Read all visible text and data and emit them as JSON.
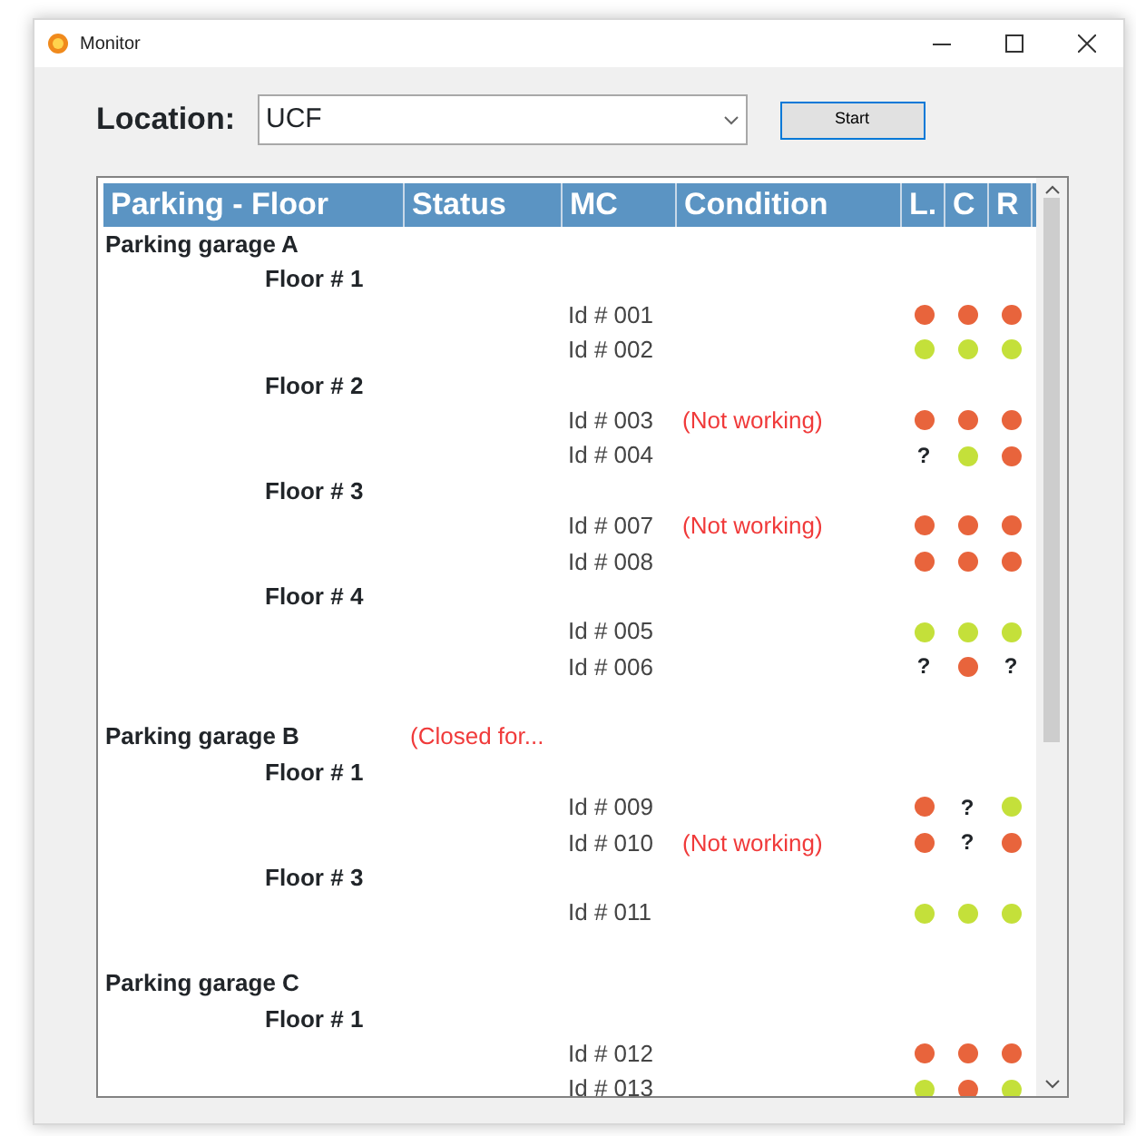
{
  "window": {
    "title": "Monitor"
  },
  "location": {
    "label": "Location:",
    "value": "UCF"
  },
  "start_button": "Start",
  "table": {
    "columns": [
      "Parking - Floor",
      "Status",
      "MC",
      "Condition",
      "L.",
      "C",
      "R"
    ],
    "garages": [
      {
        "name": "Parking garage A",
        "children": [
          {
            "name": "Floor # 1",
            "children": [
              {
                "id": "Id # 001",
                "indicators": [
                  {
                    "kind": "light",
                    "color": "#e8643c"
                  },
                  {
                    "kind": "light",
                    "color": "#e8643c"
                  },
                  {
                    "kind": "light",
                    "color": "#e8643c"
                  }
                ]
              },
              {
                "id": "Id # 002",
                "indicators": [
                  {
                    "kind": "light",
                    "color": "#c4e03a"
                  },
                  {
                    "kind": "light",
                    "color": "#c4e03a"
                  },
                  {
                    "kind": "light",
                    "color": "#c4e03a"
                  }
                ]
              }
            ]
          },
          {
            "name": "Floor # 2",
            "children": [
              {
                "id": "Id # 003",
                "condition": "(Not working)",
                "indicators": [
                  {
                    "kind": "light",
                    "color": "#e8643c"
                  },
                  {
                    "kind": "light",
                    "color": "#e8643c"
                  },
                  {
                    "kind": "light",
                    "color": "#e8643c"
                  }
                ]
              },
              {
                "id": "Id # 004",
                "indicators": [
                  {
                    "kind": "unknown",
                    "text": "?"
                  },
                  {
                    "kind": "light",
                    "color": "#c4e03a"
                  },
                  {
                    "kind": "light",
                    "color": "#e8643c"
                  }
                ]
              }
            ]
          },
          {
            "name": "Floor # 3",
            "children": [
              {
                "id": "Id # 007",
                "condition": "(Not working)",
                "indicators": [
                  {
                    "kind": "light",
                    "color": "#e8643c"
                  },
                  {
                    "kind": "light",
                    "color": "#e8643c"
                  },
                  {
                    "kind": "light",
                    "color": "#e8643c"
                  }
                ]
              },
              {
                "id": "Id # 008",
                "indicators": [
                  {
                    "kind": "light",
                    "color": "#e8643c"
                  },
                  {
                    "kind": "light",
                    "color": "#e8643c"
                  },
                  {
                    "kind": "light",
                    "color": "#e8643c"
                  }
                ]
              }
            ]
          },
          {
            "name": "Floor # 4",
            "children": [
              {
                "id": "Id # 005",
                "indicators": [
                  {
                    "kind": "light",
                    "color": "#c4e03a"
                  },
                  {
                    "kind": "light",
                    "color": "#c4e03a"
                  },
                  {
                    "kind": "light",
                    "color": "#c4e03a"
                  }
                ]
              },
              {
                "id": "Id # 006",
                "indicators": [
                  {
                    "kind": "unknown",
                    "text": "?"
                  },
                  {
                    "kind": "light",
                    "color": "#e8643c"
                  },
                  {
                    "kind": "unknown",
                    "text": "?"
                  }
                ]
              }
            ]
          }
        ]
      },
      {
        "name": "Parking garage B",
        "status": "(Closed for...",
        "children": [
          {
            "name": "Floor # 1",
            "children": [
              {
                "id": "Id # 009",
                "indicators": [
                  {
                    "kind": "light",
                    "color": "#e8643c"
                  },
                  {
                    "kind": "unknown",
                    "text": "?"
                  },
                  {
                    "kind": "light",
                    "color": "#c4e03a"
                  }
                ]
              },
              {
                "id": "Id # 010",
                "condition": "(Not working)",
                "indicators": [
                  {
                    "kind": "light",
                    "color": "#e8643c"
                  },
                  {
                    "kind": "unknown",
                    "text": "?"
                  },
                  {
                    "kind": "light",
                    "color": "#e8643c"
                  }
                ]
              }
            ]
          },
          {
            "name": "Floor # 3",
            "children": [
              {
                "id": "Id # 011",
                "indicators": [
                  {
                    "kind": "light",
                    "color": "#c4e03a"
                  },
                  {
                    "kind": "light",
                    "color": "#c4e03a"
                  },
                  {
                    "kind": "light",
                    "color": "#c4e03a"
                  }
                ]
              }
            ]
          }
        ]
      },
      {
        "name": "Parking garage C",
        "children": [
          {
            "name": "Floor # 1",
            "children": [
              {
                "id": "Id # 012",
                "indicators": [
                  {
                    "kind": "light",
                    "color": "#e8643c"
                  },
                  {
                    "kind": "light",
                    "color": "#e8643c"
                  },
                  {
                    "kind": "light",
                    "color": "#e8643c"
                  }
                ]
              },
              {
                "id": "Id # 013",
                "indicators": [
                  {
                    "kind": "light",
                    "color": "#c4e03a"
                  },
                  {
                    "kind": "light",
                    "color": "#e8643c"
                  },
                  {
                    "kind": "light",
                    "color": "#c4e03a"
                  }
                ]
              }
            ]
          }
        ]
      }
    ]
  }
}
